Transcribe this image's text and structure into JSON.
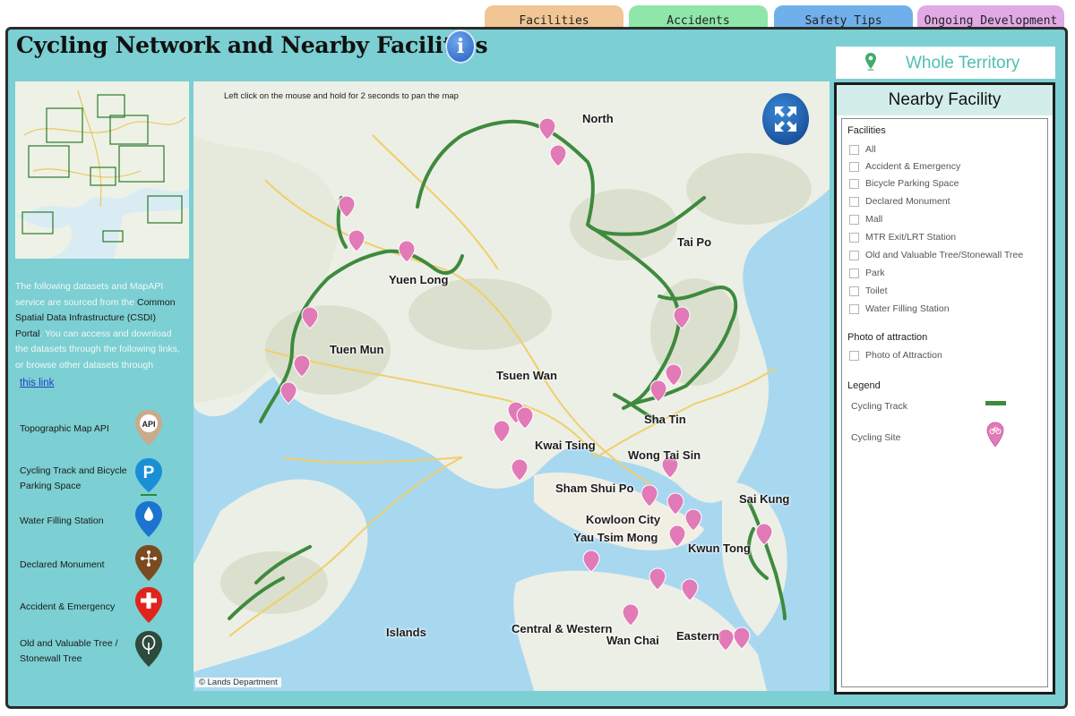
{
  "tabs": [
    {
      "label": "Facilities",
      "color": "#f1c594"
    },
    {
      "label": "Accidents",
      "color": "#8fe6a9"
    },
    {
      "label": "Safety Tips",
      "color": "#6fb0ea"
    },
    {
      "label": "Ongoing Development",
      "color": "#e1a9e6"
    }
  ],
  "header": {
    "title": "Cycling Network and Nearby Facilities",
    "info_icon": "info-icon",
    "info_glyph": "i"
  },
  "region": {
    "label": "Whole Territory",
    "icon": "map-pin-icon"
  },
  "sources": {
    "intro_part1": "The following datasets and MapAPI service are sourced from the ",
    "intro_strong": "Common Spatial Data Infrastructure (CSDI) Portal",
    "intro_part2": ". You can access and download the datasets through the following links, or browse other datasets through",
    "link_label": "this link",
    "items": [
      {
        "label": "Topographic Map API",
        "icon": "api-pin-icon",
        "icon_text": "API",
        "color": "#c9aa8a"
      },
      {
        "label": "Cycling Track and Bicycle Parking Space",
        "icon": "parking-pin-icon",
        "icon_text": "P",
        "color": "#1a8fd6"
      },
      {
        "label": "Water Filling Station",
        "icon": "water-drop-pin-icon",
        "icon_text": "",
        "color": "#1a74d0"
      },
      {
        "label": "Declared Monument",
        "icon": "monument-pin-icon",
        "icon_text": "",
        "color": "#7a4a20"
      },
      {
        "label": "Accident & Emergency",
        "icon": "first-aid-pin-icon",
        "icon_text": "",
        "color": "#e0241d"
      },
      {
        "label": "Old and Valuable Tree / Stonewall Tree",
        "icon": "tree-pin-icon",
        "icon_text": "",
        "color": "#2e4a3c"
      }
    ]
  },
  "map": {
    "hint": "Left click on the mouse and hold for 2 seconds to pan the map",
    "credit": "© Lands Department",
    "expand_icon": "expand-icon",
    "districts": [
      "North",
      "Tai Po",
      "Yuen Long",
      "Tuen Mun",
      "Tsuen Wan",
      "Sha Tin",
      "Kwai Tsing",
      "Wong Tai Sin",
      "Sham Shui Po",
      "Sai Kung",
      "Kowloon City",
      "Yau Tsim Mong",
      "Kwun Tong",
      "Islands",
      "Central & Western",
      "Wan Chai",
      "Eastern"
    ],
    "track_color": "#3e8a3e",
    "site_color": "#e27ab7"
  },
  "nearby": {
    "title": "Nearby Facility",
    "facilities_label": "Facilities",
    "facilities": [
      "All",
      "Accident & Emergency",
      "Bicycle Parking Space",
      "Declared Monument",
      "Mall",
      "MTR Exit/LRT Station",
      "Old and Valuable Tree/Stonewall Tree",
      "Park",
      "Toilet",
      "Water Filling Station"
    ],
    "photo_label": "Photo of attraction",
    "photo_options": [
      "Photo of Attraction"
    ],
    "legend_label": "Legend",
    "legend": [
      {
        "label": "Cycling Track",
        "icon": "cycling-track-line-icon"
      },
      {
        "label": "Cycling Site",
        "icon": "cycling-site-pin-icon"
      }
    ]
  }
}
